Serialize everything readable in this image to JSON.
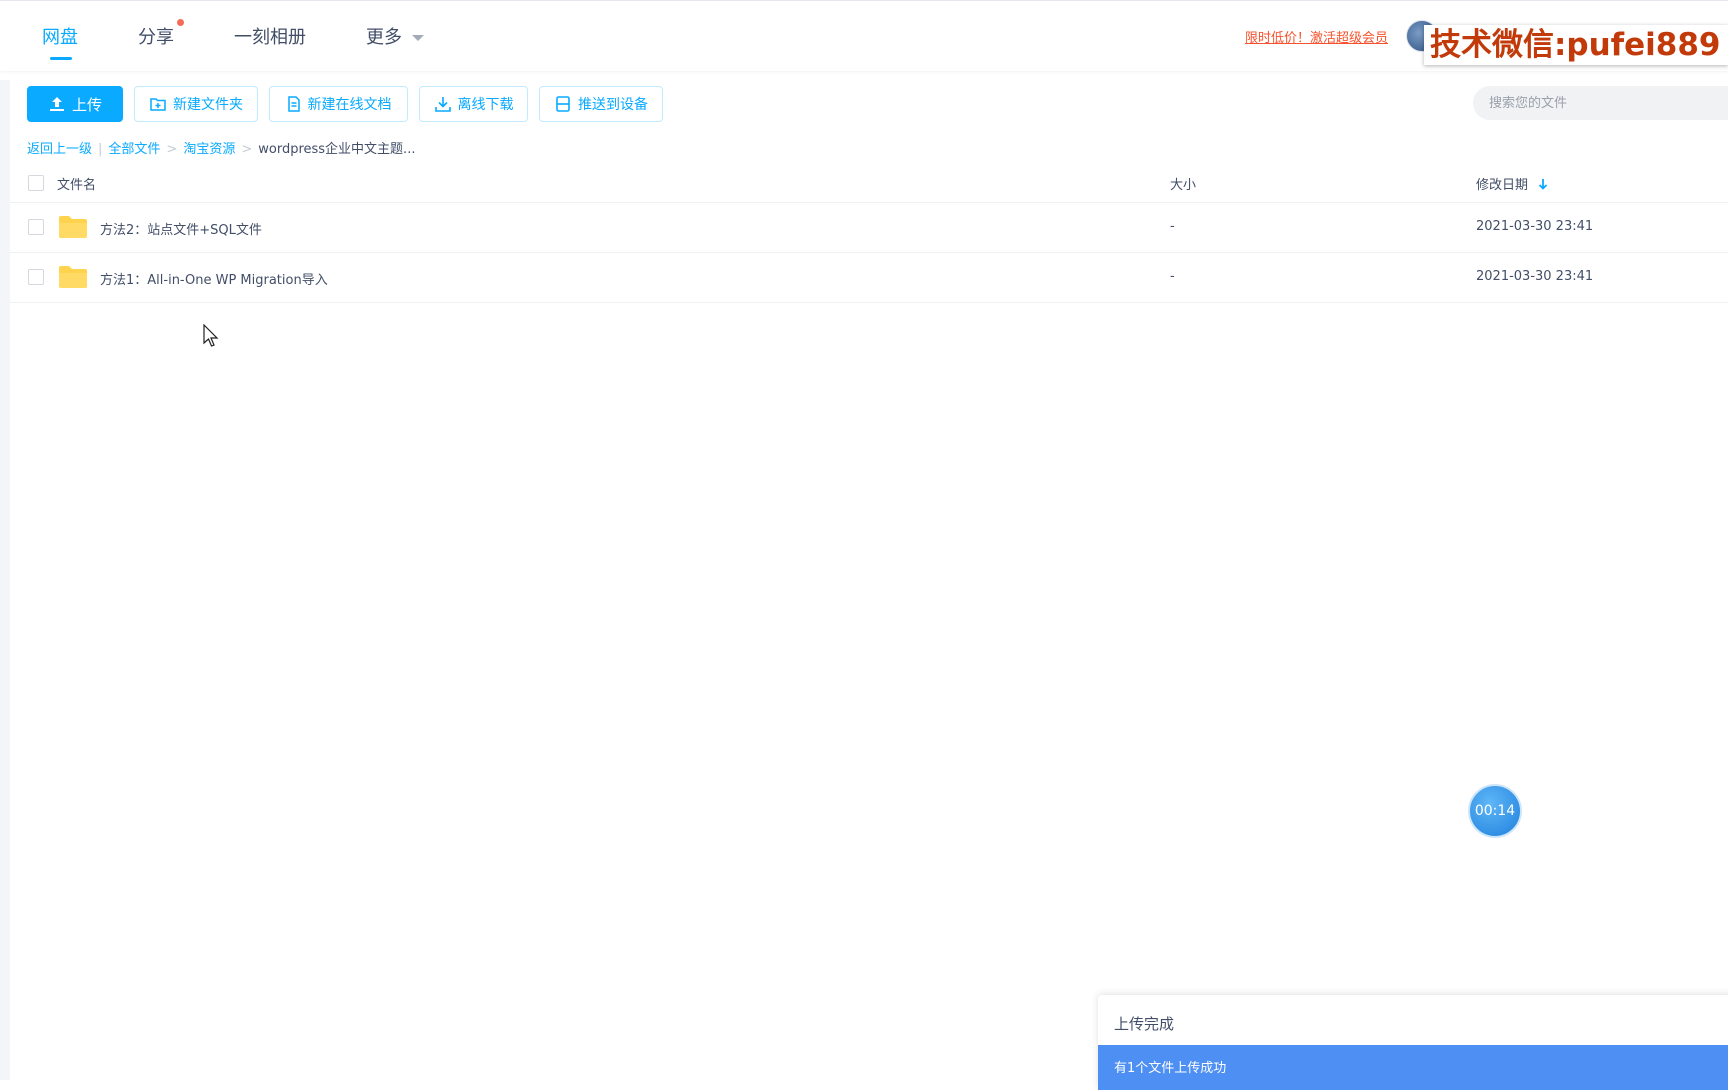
{
  "nav": {
    "tabs": [
      {
        "label": "网盘",
        "active": true
      },
      {
        "label": "分享",
        "badge": true
      },
      {
        "label": "一刻相册"
      },
      {
        "label": "更多"
      }
    ],
    "promo": "限时低价！激活超级会员",
    "watermark": "技术微信:pufei889"
  },
  "toolbar": {
    "upload": "上传",
    "new_folder": "新建文件夹",
    "new_doc": "新建在线文档",
    "offline_download": "离线下载",
    "push_device": "推送到设备",
    "search_placeholder": "搜索您的文件"
  },
  "breadcrumb": {
    "back": "返回上一级",
    "sep1": "|",
    "all": "全部文件",
    "sep2": ">",
    "folder": "淘宝资源",
    "sep3": ">",
    "current": "wordpress企业中文主题..."
  },
  "table": {
    "headers": {
      "name": "文件名",
      "size": "大小",
      "date": "修改日期"
    },
    "rows": [
      {
        "name": "方法2：站点文件+SQL文件",
        "size": "-",
        "date": "2021-03-30 23:41"
      },
      {
        "name": "方法1：All-in-One WP Migration导入",
        "size": "-",
        "date": "2021-03-30 23:41"
      }
    ]
  },
  "timer": "00:14",
  "upload": {
    "title": "上传完成",
    "message": "有1个文件上传成功"
  },
  "colors": {
    "accent": "#09aaff",
    "promo": "#f5522d",
    "folder": "#ffd34d",
    "upload_bar": "#4d8ff3"
  }
}
